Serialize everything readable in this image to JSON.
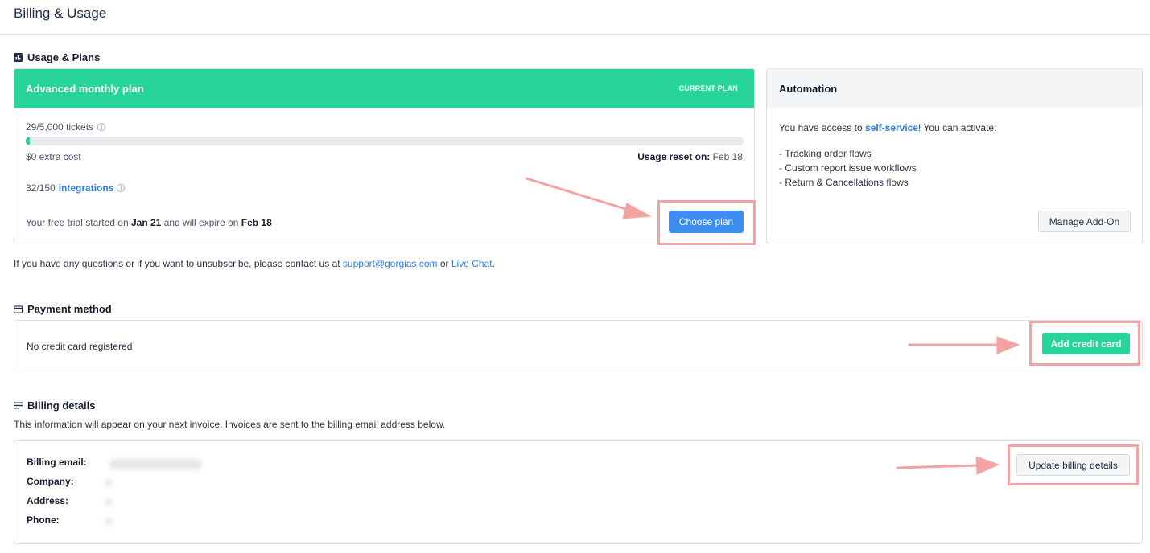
{
  "page": {
    "title": "Billing & Usage"
  },
  "usage_section": {
    "heading": "Usage & Plans",
    "icon": "bar-chart-icon"
  },
  "plan": {
    "name": "Advanced monthly plan",
    "badge": "CURRENT PLAN",
    "tickets": "29/5,000 tickets",
    "tickets_progress": 0.0058,
    "extra_cost": "$0 extra cost",
    "usage_reset_label": "Usage reset on:",
    "usage_reset_date": "Feb 18",
    "integrations_count": "32/150",
    "integrations_link": "integrations",
    "trial_prefix": "Your free trial started on",
    "trial_start": "Jan 21",
    "trial_middle": "and will expire on",
    "trial_end": "Feb 18",
    "choose_plan_label": "Choose plan"
  },
  "automation": {
    "title": "Automation",
    "access_prefix": "You have access to",
    "access_link": "self-service",
    "access_suffix": "! You can activate:",
    "features": [
      "- Tracking order flows",
      "- Custom report issue workflows",
      "- Return & Cancellations flows"
    ],
    "manage_label": "Manage Add-On"
  },
  "contact": {
    "prefix": "If you have any questions or if you want to unsubscribe, please contact us at",
    "email": "support@gorgias.com",
    "middle": "or",
    "chat": "Live Chat",
    "suffix": "."
  },
  "payment": {
    "heading": "Payment method",
    "icon": "credit-card-icon",
    "no_card_text": "No credit card registered",
    "add_card_label": "Add credit card"
  },
  "billing": {
    "heading": "Billing details",
    "icon": "lines-icon",
    "subtext": "This information will appear on your next invoice. Invoices are sent to the billing email address below.",
    "labels": {
      "email": "Billing email:",
      "company": "Company:",
      "address": "Address:",
      "phone": "Phone:"
    },
    "update_label": "Update billing details"
  },
  "colors": {
    "accent_green": "#27d49a",
    "accent_blue": "#3e8df0",
    "annotation": "#f4a3a3"
  }
}
